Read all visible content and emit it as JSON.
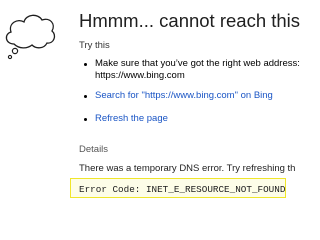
{
  "icon": "thought-cloud-icon",
  "title": "Hmmm... cannot reach this page",
  "try_label": "Try this",
  "suggestions": [
    {
      "line1": "Make sure that you’ve got the right web address:",
      "line2": "https://www.bing.com"
    },
    {
      "label": "Search for \"https://www.bing.com\" on Bing"
    },
    {
      "label": "Refresh the page"
    }
  ],
  "details_label": "Details",
  "details_text": "There was a temporary DNS error. Try refreshing th",
  "error_code": "Error Code: INET_E_RESOURCE_NOT_FOUND",
  "colors": {
    "link": "#1a55c5",
    "highlight_border": "#f0e62a"
  }
}
